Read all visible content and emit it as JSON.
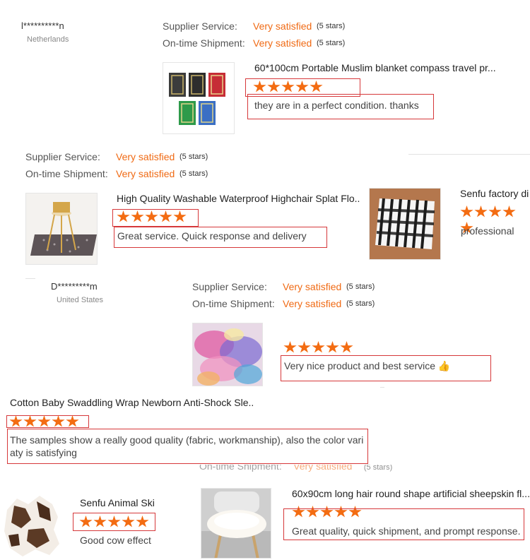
{
  "labels": {
    "supplier_service": "Supplier Service:",
    "ontime_shipment": "On-time Shipment:",
    "rating_value": "Very satisfied",
    "rating_stars": "(5 stars)"
  },
  "reviews": [
    {
      "user": "l**********n",
      "country": "Netherlands",
      "title": "60*100cm Portable Muslim blanket compass travel pr...",
      "stars": 5,
      "text": "they are in a perfect condition. thanks",
      "image_icon": "prayer-mats-icon"
    },
    {
      "title": "High Quality Washable Waterproof Highchair Splat Flo...",
      "stars": 5,
      "text": "Great service. Quick response and delivery",
      "image_icon": "highchair-mat-icon"
    },
    {
      "title": "Senfu factory di",
      "stars": 5,
      "text": "professional",
      "image_icon": "striped-rug-icon"
    },
    {
      "user": "D*********m",
      "country": "United States",
      "stars": 5,
      "text": "Very nice product and best service",
      "emoji": "👍",
      "image_icon": "tie-dye-rug-icon"
    },
    {
      "title": "Cotton Baby Swaddling Wrap Newborn Anti-Shock Sle...",
      "stars": 5,
      "text_line1": "The samples show a really good quality (fabric, workmanship), also the color vari",
      "text_line2": "aty is satisfying"
    },
    {
      "title": "Senfu Animal Ski",
      "stars": 5,
      "text": "Good cow effect",
      "image_icon": "cowhide-rug-icon"
    },
    {
      "title": "60x90cm long hair round shape artificial sheepskin fl...",
      "stars": 5,
      "text": "Great quality, quick shipment, and prompt response.",
      "image_icon": "sheepskin-chair-icon"
    }
  ],
  "colors": {
    "accent": "#f06a14",
    "star": "#f36c12",
    "annotation_box": "#d6383a"
  }
}
